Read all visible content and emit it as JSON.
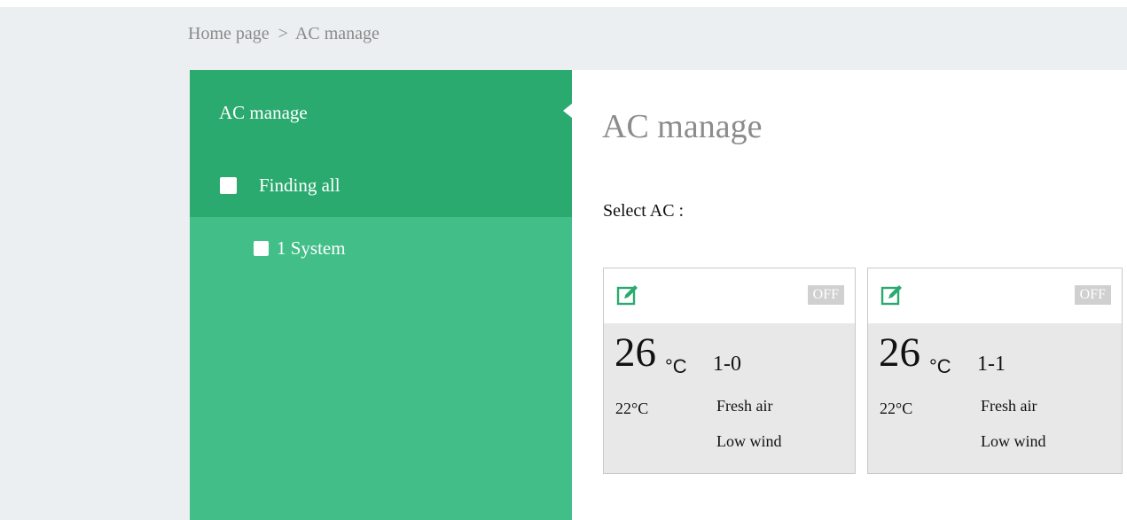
{
  "breadcrumb": {
    "home": "Home page",
    "separator": ">",
    "current": "AC manage"
  },
  "sidebar": {
    "title": "AC manage",
    "tree": [
      {
        "label": "Finding all",
        "checked": false
      },
      {
        "label": "1 System",
        "checked": false
      }
    ]
  },
  "main": {
    "title": "AC manage",
    "select_label": "Select AC :"
  },
  "cards": [
    {
      "icon": "edit-icon",
      "status": "OFF",
      "temperature": "26",
      "temp_unit": "°C",
      "id": "1-0",
      "set_temperature": "22°C",
      "mode": "Fresh air",
      "wind": "Low wind"
    },
    {
      "icon": "edit-icon",
      "status": "OFF",
      "temperature": "26",
      "temp_unit": "°C",
      "id": "1-1",
      "set_temperature": "22°C",
      "mode": "Fresh air",
      "wind": "Low wind"
    }
  ],
  "colors": {
    "sidebar_header": "#2aaa6f",
    "sidebar_body": "#42be88",
    "accent_icon": "#2aaa6f",
    "badge_bg": "#d0d0d0",
    "page_bg": "#eceff1"
  }
}
